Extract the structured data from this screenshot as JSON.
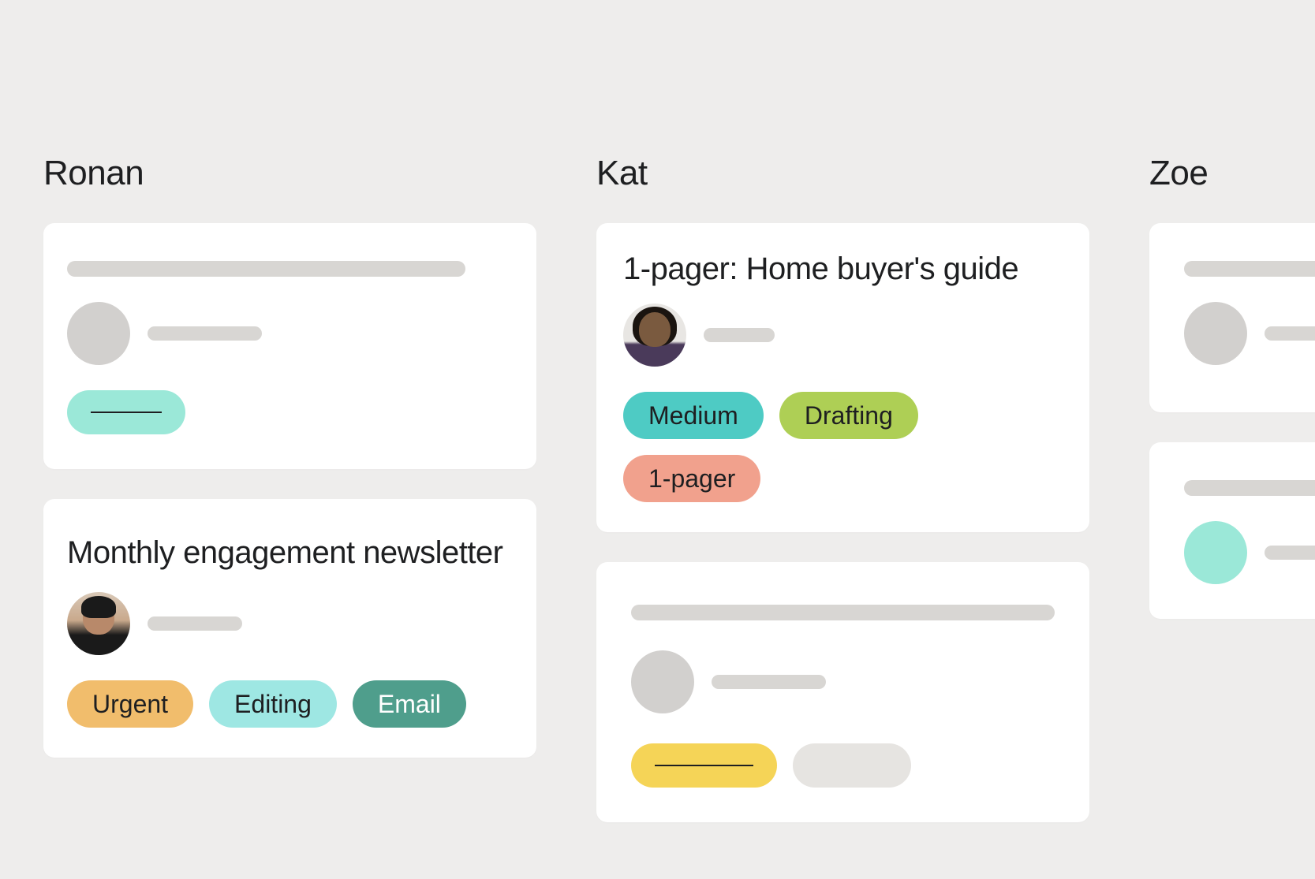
{
  "columns": [
    {
      "name": "Ronan",
      "cards": [
        {
          "type": "skeleton",
          "tags": [
            {
              "style": "skel-teal"
            }
          ]
        },
        {
          "type": "full",
          "title": "Monthly engagement newsletter",
          "assignee": "ronan",
          "tags": [
            {
              "label": "Urgent",
              "style": "urgent"
            },
            {
              "label": "Editing",
              "style": "editing"
            },
            {
              "label": "Email",
              "style": "email"
            }
          ]
        }
      ]
    },
    {
      "name": "Kat",
      "cards": [
        {
          "type": "full",
          "title": "1-pager: Home buyer's guide",
          "assignee": "kat",
          "tags": [
            {
              "label": "Medium",
              "style": "medium"
            },
            {
              "label": "Drafting",
              "style": "drafting"
            },
            {
              "label": "1-pager",
              "style": "1pager"
            }
          ]
        },
        {
          "type": "skeleton",
          "tags": [
            {
              "style": "skel-yellow"
            },
            {
              "style": "skel-gray"
            }
          ]
        }
      ]
    },
    {
      "name": "Zoe",
      "cards": [
        {
          "type": "skeleton-partial"
        },
        {
          "type": "skeleton-partial-teal"
        }
      ]
    }
  ]
}
